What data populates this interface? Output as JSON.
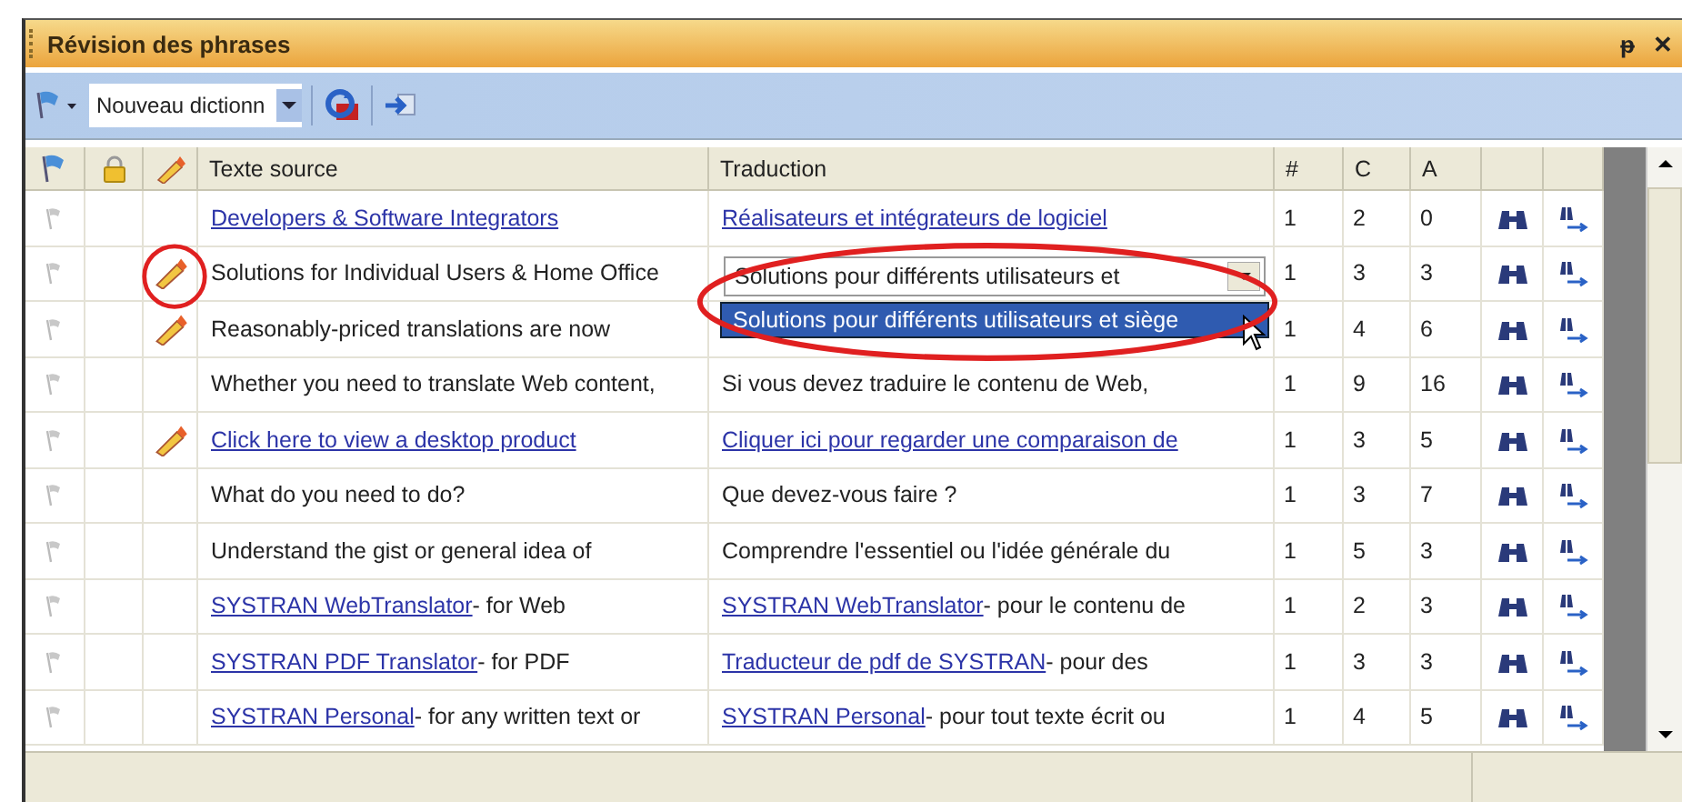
{
  "panel": {
    "title": "Révision des phrases",
    "pin": "ᵽ",
    "close": "✕"
  },
  "toolbar": {
    "dictionary": "Nouveau dictionn"
  },
  "columns": [
    "Texte source",
    "Traduction",
    "#",
    "C",
    "A"
  ],
  "rows": [
    {
      "edited": false,
      "source": {
        "link": "Developers & Software Integrators"
      },
      "translation": {
        "kind": "text",
        "link": "Réalisateurs et intégrateurs de logiciel"
      },
      "count": "1",
      "c": "2",
      "a": "0"
    },
    {
      "edited": true,
      "source": {
        "text": "Solutions for Individual Users & Home Office"
      },
      "translation": {
        "kind": "combo",
        "value": "Solutions pour différents utilisateurs et",
        "option": "Solutions pour différents utilisateurs et siège",
        "selected": true
      },
      "count": "1",
      "c": "3",
      "a": "3"
    },
    {
      "edited": true,
      "source": {
        "text": "Reasonably-priced translations are now"
      },
      "count": "1",
      "c": "4",
      "a": "6"
    },
    {
      "edited": false,
      "source": {
        "text": "Whether you need to translate Web content,"
      },
      "translation": {
        "kind": "text",
        "text": "Si vous devez traduire le contenu de Web,"
      },
      "count": "1",
      "c": "9",
      "a": "16"
    },
    {
      "edited": true,
      "source": {
        "link": "Click here to view a desktop product"
      },
      "translation": {
        "kind": "text",
        "link": "Cliquer ici pour regarder une comparaison de"
      },
      "count": "1",
      "c": "3",
      "a": "5"
    },
    {
      "edited": false,
      "source": {
        "text": "What do you need to do?"
      },
      "translation": {
        "kind": "text",
        "text": "Que devez-vous faire ?"
      },
      "count": "1",
      "c": "3",
      "a": "7"
    },
    {
      "edited": false,
      "source": {
        "text": "Understand the gist or general idea of"
      },
      "translation": {
        "kind": "text",
        "text": "Comprendre l'essentiel ou l'idée générale du"
      },
      "count": "1",
      "c": "5",
      "a": "3"
    },
    {
      "edited": false,
      "source": {
        "link": "SYSTRAN WebTranslator",
        "text": " - for Web"
      },
      "translation": {
        "kind": "text",
        "link": "SYSTRAN WebTranslator",
        "text": " - pour le contenu de"
      },
      "count": "1",
      "c": "2",
      "a": "3"
    },
    {
      "edited": false,
      "source": {
        "link": "SYSTRAN PDF Translator",
        "text": " - for PDF"
      },
      "translation": {
        "kind": "text",
        "link": "Traducteur de pdf de SYSTRAN",
        "text": " - pour des"
      },
      "count": "1",
      "c": "3",
      "a": "3"
    },
    {
      "edited": false,
      "source": {
        "link": "SYSTRAN Personal",
        "text": " - for any written text or"
      },
      "translation": {
        "kind": "text",
        "link": "SYSTRAN Personal",
        "text": " - pour tout texte écrit ou"
      },
      "count": "1",
      "c": "4",
      "a": "5"
    }
  ]
}
